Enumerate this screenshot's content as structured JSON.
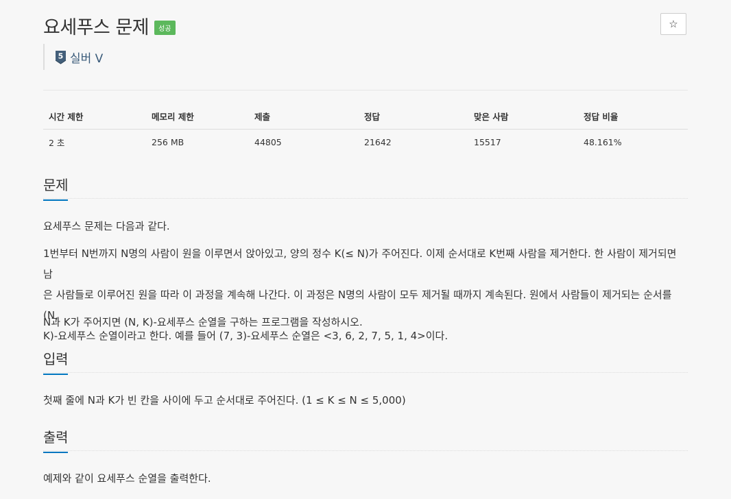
{
  "problem": {
    "title": "요세푸스 문제",
    "result_badge": "성공",
    "star_icon": "☆",
    "tier": {
      "label": "실버 V",
      "level": "5",
      "color": "#435f7a"
    }
  },
  "stats": {
    "headers": [
      "시간 제한",
      "메모리 제한",
      "제출",
      "정답",
      "맞은 사람",
      "정답 비율"
    ],
    "values": [
      "2 초",
      "256 MB",
      "44805",
      "21642",
      "15517",
      "48.161%"
    ]
  },
  "sections": {
    "description": {
      "heading": "문제",
      "p1": "요세푸스 문제는 다음과 같다.",
      "p2_line1": "1번부터 N번까지 N명의 사람이 원을 이루면서 앉아있고, 양의 정수 K(≤ N)가 주어진다. 이제 순서대로 K번째 사람을 제거한다. 한 사람이 제거되면 남",
      "p2_line2": "은 사람들로 이루어진 원을 따라 이 과정을 계속해 나간다. 이 과정은 N명의 사람이 모두 제거될 때까지 계속된다. 원에서 사람들이 제거되는 순서를 (N,",
      "p2_line3": "K)-요세푸스 순열이라고 한다. 예를 들어 (7, 3)-요세푸스 순열은 <3, 6, 2, 7, 5, 1, 4>이다.",
      "p3": "N과 K가 주어지면 (N, K)-요세푸스 순열을 구하는 프로그램을 작성하시오."
    },
    "input": {
      "heading": "입력",
      "p1": "첫째 줄에 N과 K가 빈 칸을 사이에 두고 순서대로 주어진다. (1 ≤ K ≤ N ≤ 5,000)"
    },
    "output": {
      "heading": "출력",
      "p1": "예제와 같이 요세푸스 순열을 출력한다."
    }
  },
  "colors": {
    "accent": "#0076c0",
    "success": "#5cb85c",
    "background": "#f7f7f7"
  }
}
